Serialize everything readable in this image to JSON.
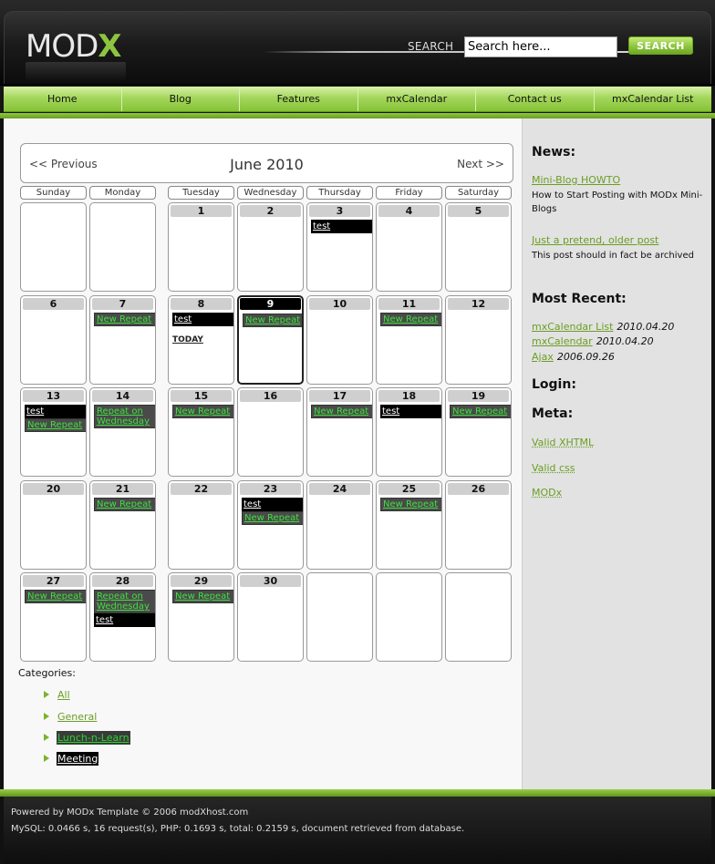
{
  "header": {
    "logo_mod": "MOD",
    "logo_x": "X",
    "search_label": "SEARCH",
    "search_placeholder": "Search here...",
    "search_button": "SEARCH"
  },
  "nav": [
    "Home",
    "Blog",
    "Features",
    "mxCalendar",
    "Contact us",
    "mxCalendar List"
  ],
  "calendar": {
    "prev": "<< Previous",
    "title": "June 2010",
    "next": "Next >>",
    "weekdays": [
      "Sunday",
      "Monday",
      "Tuesday",
      "Wednesday",
      "Thursday",
      "Friday",
      "Saturday"
    ],
    "today_label": "TODAY",
    "weeks": [
      [
        {
          "num": "",
          "events": []
        },
        {
          "num": "",
          "events": []
        },
        {
          "num": "1",
          "events": []
        },
        {
          "num": "2",
          "events": []
        },
        {
          "num": "3",
          "events": [
            {
              "label": "test",
              "kind": "test"
            }
          ]
        },
        {
          "num": "4",
          "events": []
        },
        {
          "num": "5",
          "events": []
        }
      ],
      [
        {
          "num": "6",
          "events": []
        },
        {
          "num": "7",
          "events": [
            {
              "label": "New Repeat",
              "kind": "rep"
            }
          ]
        },
        {
          "num": "8",
          "events": [
            {
              "label": "test",
              "kind": "test"
            }
          ],
          "today_text": true
        },
        {
          "num": "9",
          "today": true,
          "events": [
            {
              "label": "New Repeat",
              "kind": "rep"
            }
          ]
        },
        {
          "num": "10",
          "events": []
        },
        {
          "num": "11",
          "events": [
            {
              "label": "New Repeat",
              "kind": "rep"
            }
          ]
        },
        {
          "num": "12",
          "events": []
        }
      ],
      [
        {
          "num": "13",
          "events": [
            {
              "label": "test",
              "kind": "test"
            },
            {
              "label": "New Repeat",
              "kind": "rep"
            }
          ]
        },
        {
          "num": "14",
          "events": [
            {
              "label": "Repeat on Wednesday",
              "kind": "rep"
            }
          ]
        },
        {
          "num": "15",
          "events": [
            {
              "label": "New Repeat",
              "kind": "rep"
            }
          ]
        },
        {
          "num": "16",
          "events": []
        },
        {
          "num": "17",
          "events": [
            {
              "label": "New Repeat",
              "kind": "rep"
            }
          ]
        },
        {
          "num": "18",
          "events": [
            {
              "label": "test",
              "kind": "test"
            }
          ]
        },
        {
          "num": "19",
          "events": [
            {
              "label": "New Repeat",
              "kind": "rep"
            }
          ]
        }
      ],
      [
        {
          "num": "20",
          "events": []
        },
        {
          "num": "21",
          "events": [
            {
              "label": "New Repeat",
              "kind": "rep"
            }
          ]
        },
        {
          "num": "22",
          "events": []
        },
        {
          "num": "23",
          "events": [
            {
              "label": "test",
              "kind": "test"
            },
            {
              "label": "New Repeat",
              "kind": "rep"
            }
          ]
        },
        {
          "num": "24",
          "events": []
        },
        {
          "num": "25",
          "events": [
            {
              "label": "New Repeat",
              "kind": "rep"
            }
          ]
        },
        {
          "num": "26",
          "events": []
        }
      ],
      [
        {
          "num": "27",
          "events": [
            {
              "label": "New Repeat",
              "kind": "rep"
            }
          ]
        },
        {
          "num": "28",
          "events": [
            {
              "label": "Repeat on Wednesday",
              "kind": "rep"
            },
            {
              "label": "test",
              "kind": "test"
            }
          ]
        },
        {
          "num": "29",
          "events": [
            {
              "label": "New Repeat",
              "kind": "rep"
            }
          ]
        },
        {
          "num": "30",
          "events": []
        },
        {
          "num": "",
          "events": []
        },
        {
          "num": "",
          "events": []
        },
        {
          "num": "",
          "events": []
        }
      ]
    ]
  },
  "categories": {
    "label": "Categories:",
    "items": [
      {
        "label": "All",
        "style": "plain"
      },
      {
        "label": "General",
        "style": "plain"
      },
      {
        "label": "Lunch-n-Learn",
        "style": "lunch"
      },
      {
        "label": "Meeting",
        "style": "meet"
      }
    ]
  },
  "sidebar": {
    "news_heading": "News:",
    "news": [
      {
        "title": "Mini-Blog HOWTO",
        "text": "How to Start Posting with MODx Mini-Blogs"
      },
      {
        "title": "Just a pretend, older post",
        "text": "This post should in fact be archived"
      }
    ],
    "recent_heading": "Most Recent:",
    "recent": [
      {
        "title": "mxCalendar List",
        "date": "2010.04.20"
      },
      {
        "title": "mxCalendar",
        "date": "2010.04.20"
      },
      {
        "title": "Ajax",
        "date": "2006.09.26"
      }
    ],
    "login_heading": "Login:",
    "meta_heading": "Meta:",
    "meta": [
      "Valid XHTML",
      "Valid css",
      "MODx"
    ]
  },
  "footer": {
    "line1": "Powered by MODx  Template © 2006 modXhost.com",
    "line2": "MySQL: 0.0466 s, 16 request(s), PHP: 0.1693 s, total: 0.2159 s, document retrieved from database."
  },
  "colors": {
    "accent_green": "#8cc63f",
    "event_link_green": "#3ee03e"
  }
}
